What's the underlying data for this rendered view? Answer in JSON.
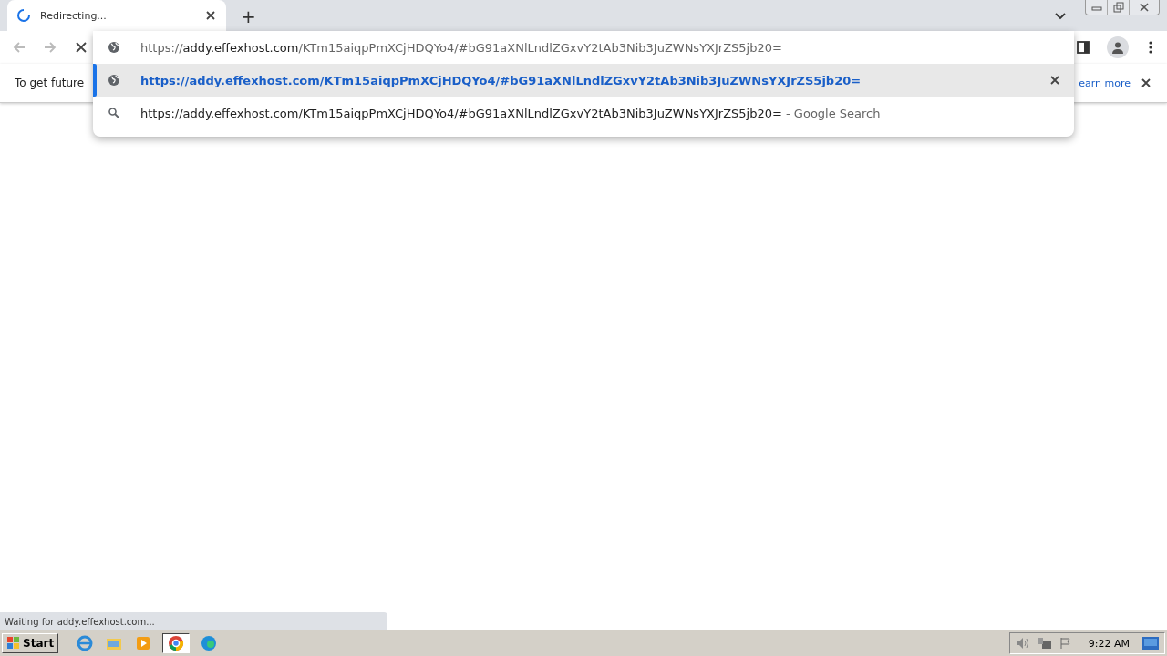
{
  "tab": {
    "title": "Redirecting...",
    "loading": true
  },
  "new_tab": "+",
  "address": {
    "scheme": "https://",
    "host": "addy.effexhost.com",
    "path": "/KTm15aiqpPmXCjHDQYo4/#bG91aXNlLndlZGxvY2tAb3Nib3JuZWNsYXJrZS5jb20="
  },
  "suggestions": [
    {
      "kind": "url",
      "selected": true,
      "text": "https://addy.effexhost.com/KTm15aiqpPmXCjHDQYo4/#bG91aXNlLndlZGxvY2tAb3Nib3JuZWNsYXJrZS5jb20="
    },
    {
      "kind": "search",
      "selected": false,
      "text": "https://addy.effexhost.com/KTm15aiqpPmXCjHDQYo4/#bG91aXNlLndlZGxvY2tAb3Nib3JuZWNsYXJrZS5jb20=",
      "suffix": "- Google Search"
    }
  ],
  "infobar": {
    "text": "To get future",
    "link": "earn more"
  },
  "status": "Waiting for addy.effexhost.com...",
  "taskbar": {
    "start": "Start",
    "clock": "9:22 AM"
  }
}
